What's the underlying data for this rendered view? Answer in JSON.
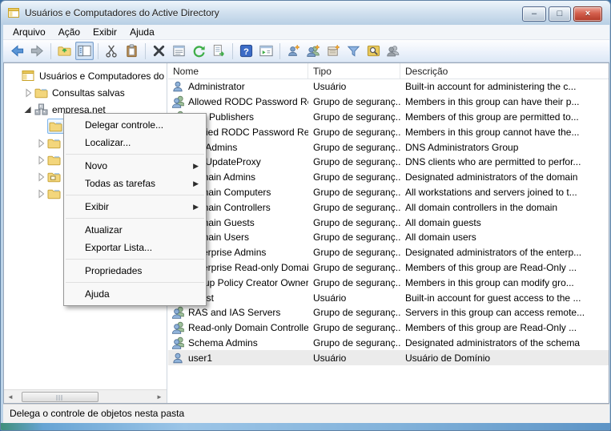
{
  "window": {
    "title": "Usuários e Computadores do Active Directory",
    "caption_buttons": {
      "minimize": "–",
      "maximize": "□",
      "close": "×"
    }
  },
  "menubar": {
    "items": [
      "Arquivo",
      "Ação",
      "Exibir",
      "Ajuda"
    ]
  },
  "toolbar": {
    "items": [
      {
        "icon": "back"
      },
      {
        "icon": "forward"
      },
      {
        "sep": true
      },
      {
        "icon": "up-level"
      },
      {
        "icon": "show-console-tree",
        "pressed": true
      },
      {
        "sep": true
      },
      {
        "icon": "cut"
      },
      {
        "icon": "paste"
      },
      {
        "sep": true
      },
      {
        "icon": "delete"
      },
      {
        "icon": "properties"
      },
      {
        "icon": "refresh"
      },
      {
        "icon": "export-list"
      },
      {
        "sep": true
      },
      {
        "icon": "help"
      },
      {
        "icon": "new-window"
      },
      {
        "sep": true
      },
      {
        "icon": "new-user"
      },
      {
        "icon": "new-group"
      },
      {
        "icon": "new-ou"
      },
      {
        "icon": "filter"
      },
      {
        "icon": "find"
      },
      {
        "icon": "select-users"
      }
    ]
  },
  "tree": {
    "items": [
      {
        "label": "Usuários e Computadores do Ac",
        "icon": "console",
        "level": 0,
        "expander": "none"
      },
      {
        "label": "Consultas salvas",
        "icon": "folder",
        "level": 1,
        "expander": "collapsed"
      },
      {
        "label": "empresa.net",
        "icon": "domain",
        "level": 1,
        "expander": "expanded"
      },
      {
        "label": "",
        "icon": "folder",
        "level": 2,
        "expander": "none",
        "selected": true
      },
      {
        "label": "",
        "icon": "folder",
        "level": 2,
        "expander": "collapsed"
      },
      {
        "label": "",
        "icon": "folder",
        "level": 2,
        "expander": "collapsed"
      },
      {
        "label": "",
        "icon": "folder-ou",
        "level": 2,
        "expander": "collapsed"
      },
      {
        "label": "",
        "icon": "folder",
        "level": 2,
        "expander": "collapsed"
      }
    ]
  },
  "context_menu": {
    "items": [
      {
        "label": "Delegar controle..."
      },
      {
        "label": "Localizar..."
      },
      {
        "separator": true
      },
      {
        "label": "Novo",
        "submenu": true
      },
      {
        "label": "Todas as tarefas",
        "submenu": true
      },
      {
        "separator": true
      },
      {
        "label": "Exibir",
        "submenu": true
      },
      {
        "separator": true
      },
      {
        "label": "Atualizar"
      },
      {
        "label": "Exportar Lista..."
      },
      {
        "separator": true
      },
      {
        "label": "Propriedades"
      },
      {
        "separator": true
      },
      {
        "label": "Ajuda"
      }
    ]
  },
  "list": {
    "columns": [
      "Nome",
      "Tipo",
      "Descrição"
    ],
    "rows": [
      {
        "icon": "user",
        "name": "Administrator",
        "type": "Usuário",
        "description": "Built-in account for administering the c..."
      },
      {
        "icon": "group",
        "name": "Allowed RODC Password Re...",
        "type": "Grupo de seguranç...",
        "description": "Members in this group can have their p..."
      },
      {
        "icon": "group",
        "name": "Cert Publishers",
        "type": "Grupo de seguranç...",
        "description": "Members of this group are permitted to..."
      },
      {
        "icon": "group",
        "name": "Denied RODC Password Repl...",
        "type": "Grupo de seguranç...",
        "description": "Members in this group cannot have the..."
      },
      {
        "icon": "group",
        "name": "DnsAdmins",
        "type": "Grupo de seguranç...",
        "description": "DNS Administrators Group"
      },
      {
        "icon": "group",
        "name": "DnsUpdateProxy",
        "type": "Grupo de seguranç...",
        "description": "DNS clients who are permitted to perfor..."
      },
      {
        "icon": "group",
        "name": "Domain Admins",
        "type": "Grupo de seguranç...",
        "description": "Designated administrators of the domain"
      },
      {
        "icon": "group",
        "name": "Domain Computers",
        "type": "Grupo de seguranç...",
        "description": "All workstations and servers joined to t..."
      },
      {
        "icon": "group",
        "name": "Domain Controllers",
        "type": "Grupo de seguranç...",
        "description": "All domain controllers in the domain"
      },
      {
        "icon": "group",
        "name": "Domain Guests",
        "type": "Grupo de seguranç...",
        "description": "All domain guests"
      },
      {
        "icon": "group",
        "name": "Domain Users",
        "type": "Grupo de seguranç...",
        "description": "All domain users"
      },
      {
        "icon": "group",
        "name": "Enterprise Admins",
        "type": "Grupo de seguranç...",
        "description": "Designated administrators of the enterp..."
      },
      {
        "icon": "group",
        "name": "Enterprise Read-only Domai...",
        "type": "Grupo de seguranç...",
        "description": "Members of this group are Read-Only ..."
      },
      {
        "icon": "group",
        "name": "Group Policy Creator Owners",
        "type": "Grupo de seguranç...",
        "description": "Members in this group can modify gro..."
      },
      {
        "icon": "user",
        "name": "Guest",
        "type": "Usuário",
        "description": "Built-in account for guest access to the ..."
      },
      {
        "icon": "group",
        "name": "RAS and IAS Servers",
        "type": "Grupo de seguranç...",
        "description": "Servers in this group can access remote..."
      },
      {
        "icon": "group",
        "name": "Read-only Domain Controllers",
        "type": "Grupo de seguranç...",
        "description": "Members of this group are Read-Only ..."
      },
      {
        "icon": "group",
        "name": "Schema Admins",
        "type": "Grupo de seguranç...",
        "description": "Designated administrators of the schema"
      },
      {
        "icon": "user",
        "name": "user1",
        "type": "Usuário",
        "description": "Usuário de Domínio",
        "selected": true
      }
    ]
  },
  "statusbar": {
    "text": "Delega o controle de objetos nesta pasta"
  },
  "colors": {
    "selection_fill": "#d7eafc",
    "selection_border": "#7eb4ea",
    "close_button_red": "#b03a28",
    "help_blue": "#3b6bc6",
    "titlebar_glass": "#cfe0ef"
  }
}
